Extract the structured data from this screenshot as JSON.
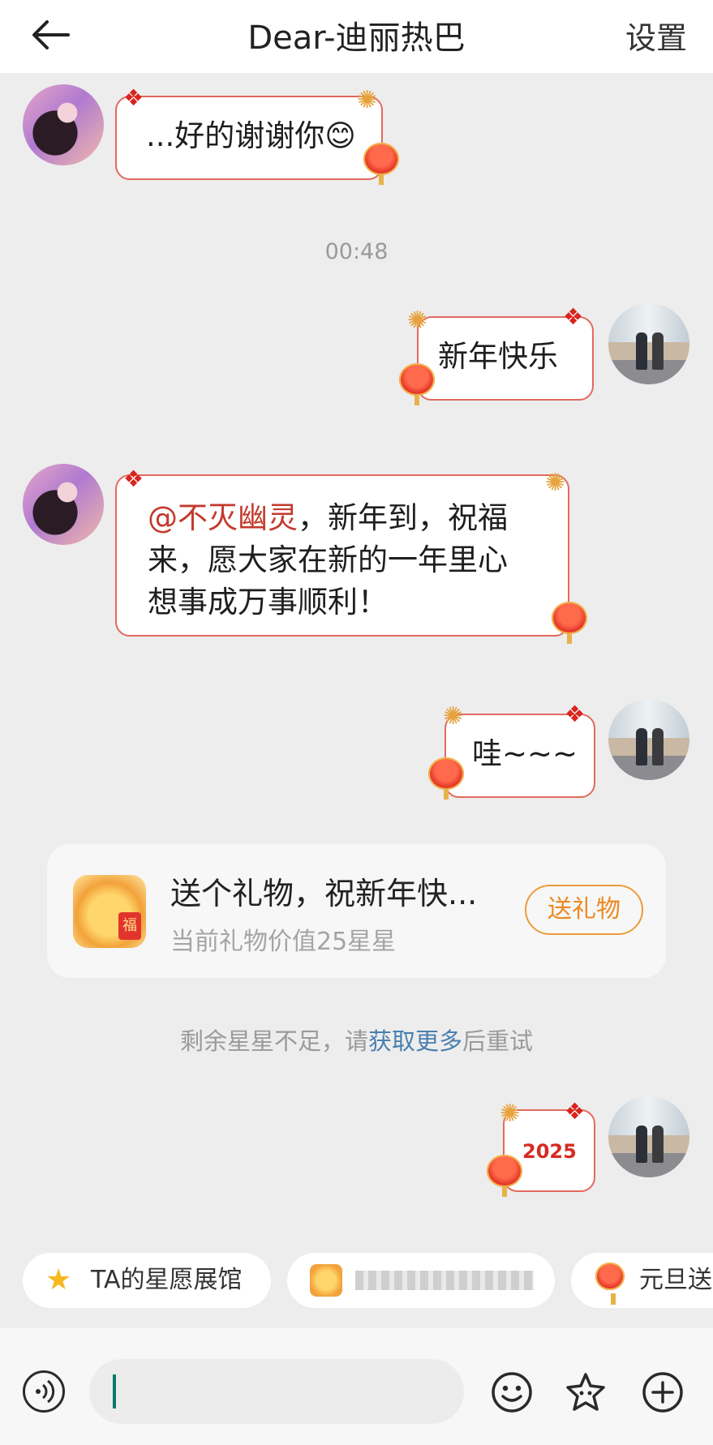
{
  "header": {
    "back_label": "back",
    "title": "Dear-迪丽热巴",
    "settings_label": "设置"
  },
  "messages": [
    {
      "side": "left",
      "text": "...好的谢谢你😊"
    },
    {
      "side": "right",
      "text": "新年快乐"
    },
    {
      "side": "left",
      "mention": "@不灭幽灵",
      "lines": [
        "，新年到，祝福",
        "来，愿大家在新的一年里心",
        "想事成万事顺利！"
      ]
    },
    {
      "side": "right",
      "text": "哇~~~"
    },
    {
      "side": "right",
      "sticker": "2025"
    }
  ],
  "timestamp": "00:48",
  "gift_card": {
    "title": "送个礼物，祝新年快...",
    "subtitle": "当前礼物价值25星星",
    "button_label": "送礼物"
  },
  "notice": {
    "prefix": "剩余星星不足，请",
    "link": "获取更多",
    "suffix": "后重试"
  },
  "quick_chips": [
    {
      "label": "TA的星愿展馆",
      "icon": "star-icon"
    },
    {
      "label": "",
      "icon": "dragon-icon",
      "blurred": true
    },
    {
      "label": "元旦送",
      "icon": "lantern-icon"
    }
  ],
  "input": {
    "placeholder": ""
  },
  "colors": {
    "accent": "#ec8a22",
    "mention": "#c23a2c",
    "link": "#4a7fb0",
    "bubble_border": "#e26a5e"
  }
}
